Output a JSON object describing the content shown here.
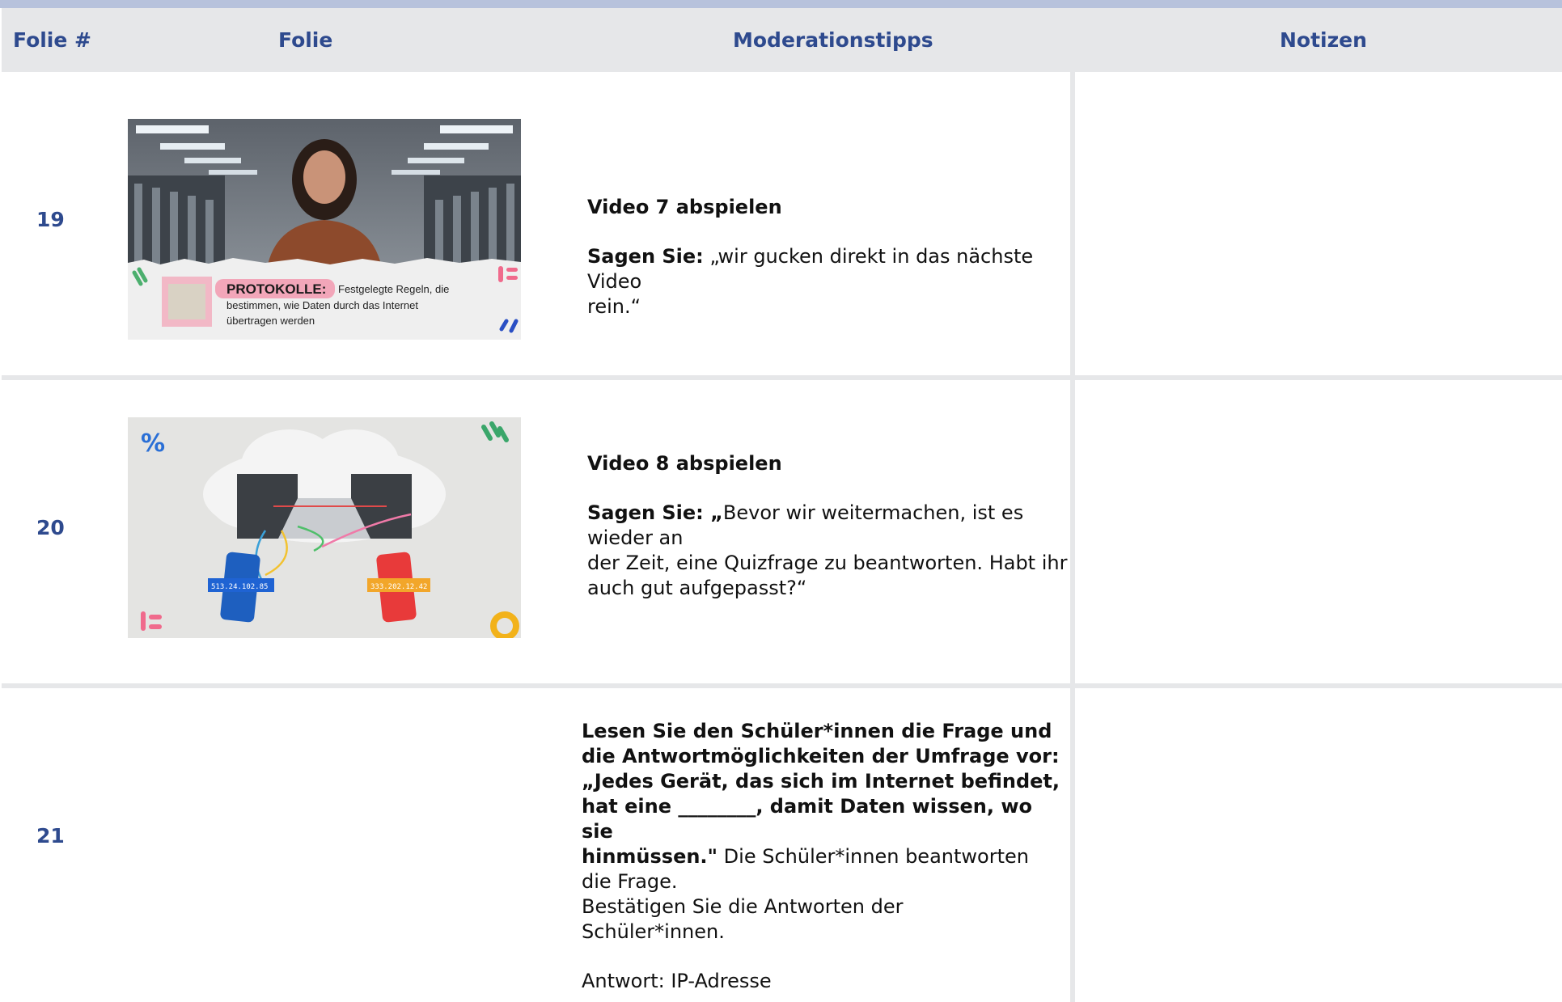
{
  "header": {
    "col_number": "Folie #",
    "col_slide": "Folie",
    "col_tips": "Moderationstipps",
    "col_notes": "Notizen"
  },
  "rows": [
    {
      "number": "19",
      "thumbnail": {
        "caption_keyword": "PROTOKOLLE:",
        "caption_text_1": "Festgelegte Regeln, die",
        "caption_text_2": "bestimmen, wie Daten durch das Internet",
        "caption_text_3": "übertragen werden"
      },
      "tips": {
        "heading": "Video 7 abspielen",
        "say_label": "Sagen Sie:",
        "say_text_1": " „wir gucken direkt in das nächste Video",
        "say_text_2": "rein.“"
      }
    },
    {
      "number": "20",
      "thumbnail": {
        "ip_left": "513.24.102.85",
        "ip_right": "333.202.12.42"
      },
      "tips": {
        "heading": "Video 8 abspielen",
        "say_label": "Sagen Sie: „",
        "say_text_1": "Bevor wir weitermachen, ist es wieder an",
        "say_text_2": "der Zeit, eine Quizfrage zu beantworten. Habt ihr",
        "say_text_3": "auch gut aufgepasst?“"
      }
    },
    {
      "number": "21",
      "tips": {
        "bold_1": "Lesen Sie den Schüler*innen die Frage und",
        "bold_2": "die Antwortmöglichkeiten der Umfrage vor:",
        "bold_3": "„Jedes Gerät, das sich im Internet befindet,",
        "bold_4": "hat eine ________, damit Daten wissen, wo sie",
        "bold_5": "hinmüssen.\"",
        "text_5": " Die Schüler*innen beantworten",
        "text_6": "die Frage.",
        "text_7": "Bestätigen Sie die Antworten der",
        "text_8": "Schüler*innen.",
        "answer": "Antwort: IP-Adresse"
      }
    }
  ]
}
